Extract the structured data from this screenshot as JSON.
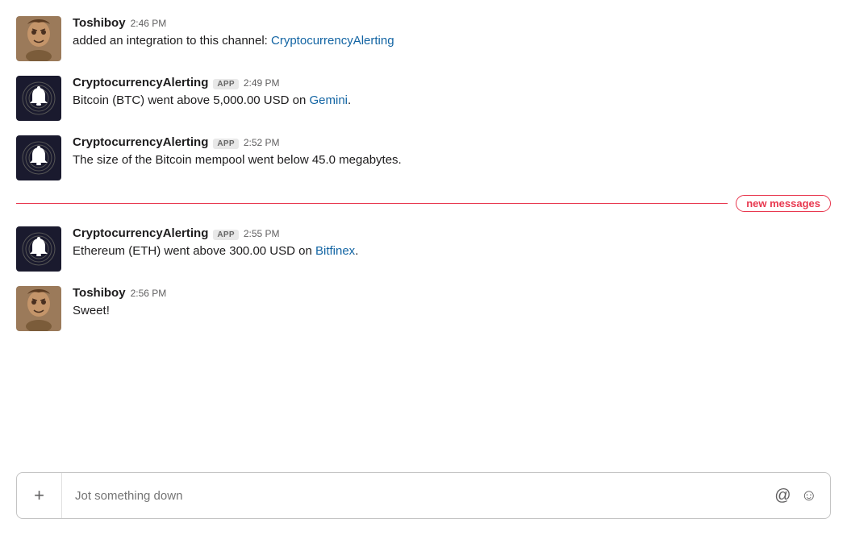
{
  "messages": [
    {
      "id": "msg1",
      "type": "user",
      "username": "Toshiboy",
      "timestamp": "2:46 PM",
      "text_prefix": "added an integration to this channel: ",
      "link_text": "CryptocurrencyAlerting",
      "link_url": "#",
      "has_badge": false
    },
    {
      "id": "msg2",
      "type": "bot",
      "username": "CryptocurrencyAlerting",
      "timestamp": "2:49 PM",
      "text": "Bitcoin (BTC) went above 5,000.00 USD on ",
      "link_text": "Gemini",
      "link_url": "#",
      "text_suffix": ".",
      "has_badge": true
    },
    {
      "id": "msg3",
      "type": "bot",
      "username": "CryptocurrencyAlerting",
      "timestamp": "2:52 PM",
      "text": "The size of the Bitcoin mempool went below 45.0 megabytes.",
      "has_badge": true
    },
    {
      "id": "msg4",
      "type": "bot",
      "username": "CryptocurrencyAlerting",
      "timestamp": "2:55 PM",
      "text": "Ethereum (ETH) went above 300.00 USD on ",
      "link_text": "Bitfinex",
      "link_url": "#",
      "text_suffix": ".",
      "has_badge": true
    },
    {
      "id": "msg5",
      "type": "user",
      "username": "Toshiboy",
      "timestamp": "2:56 PM",
      "text": "Sweet!",
      "has_badge": false
    }
  ],
  "new_messages_divider": {
    "label": "new messages",
    "after_message_id": "msg3"
  },
  "composer": {
    "placeholder": "Jot something down",
    "add_button_label": "+",
    "at_icon": "@",
    "emoji_icon": "☺"
  },
  "badges": {
    "app_label": "APP"
  }
}
